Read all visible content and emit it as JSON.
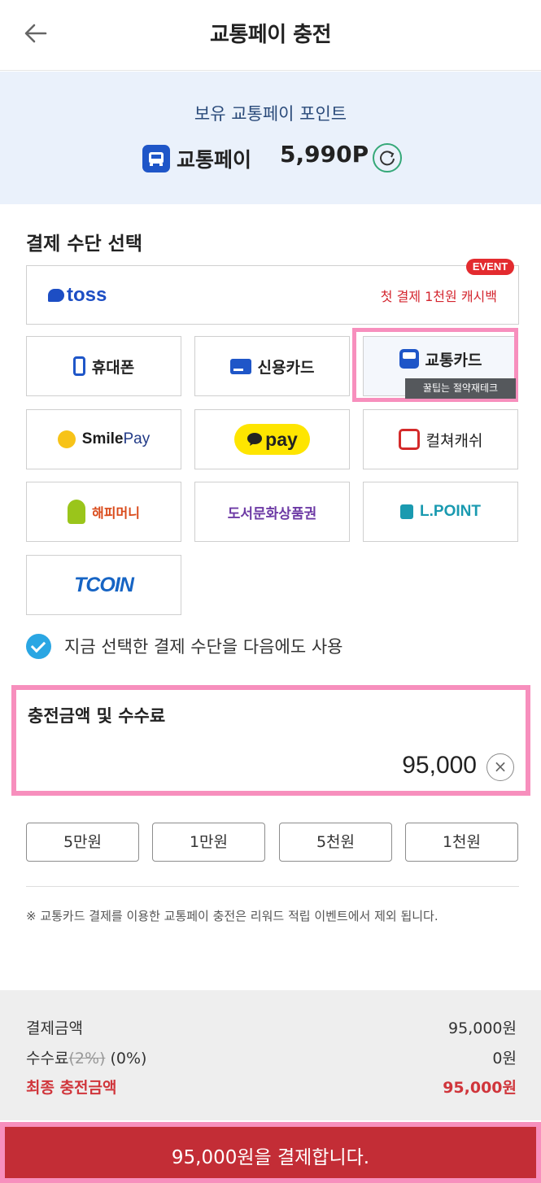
{
  "header": {
    "title": "교통페이 충전"
  },
  "points": {
    "label": "보유 교통페이 포인트",
    "name": "교통페이",
    "value": "5,990P"
  },
  "payment": {
    "section_title": "결제 수단 선택",
    "toss": {
      "logo": "toss",
      "promo": "첫 결제 1천원 캐시백",
      "badge": "EVENT"
    },
    "options": {
      "phone": "휴대폰",
      "credit_card": "신용카드",
      "transit_card": "교통카드",
      "smilepay_a": "Smile",
      "smilepay_b": "Pay",
      "kakaopay": "pay",
      "culture_cash": "컬쳐캐쉬",
      "happy_money": "해피머니",
      "book_voucher": "도서문화상품권",
      "lpoint": "L.POINT",
      "tcoin": "TCOIN"
    },
    "selected": "transit_card",
    "watermark": "꿀팁는 절약재테크",
    "remember": {
      "label": "지금 선택한 결제 수단을 다음에도 사용",
      "checked": true
    }
  },
  "amount": {
    "title": "충전금액 및 수수료",
    "value": "95,000"
  },
  "quick_amounts": [
    "5만원",
    "1만원",
    "5천원",
    "1천원"
  ],
  "notice": "※ 교통카드 결제를 이용한 교통페이 충전은 리워드 적립 이벤트에서 제외 됩니다.",
  "summary": {
    "pay_amount_label": "결제금액",
    "pay_amount_value": "95,000원",
    "fee_label": "수수료",
    "fee_old": "(2%)",
    "fee_new": "(0%)",
    "fee_value": "0원",
    "final_label": "최종 충전금액",
    "final_value": "95,000원"
  },
  "pay_button": "95,000원을 결제합니다.",
  "colors": {
    "accent_blue": "#1f56c8",
    "highlight_pink": "#f78fbd",
    "pay_red": "#c32d36",
    "text_red": "#d0353b"
  }
}
